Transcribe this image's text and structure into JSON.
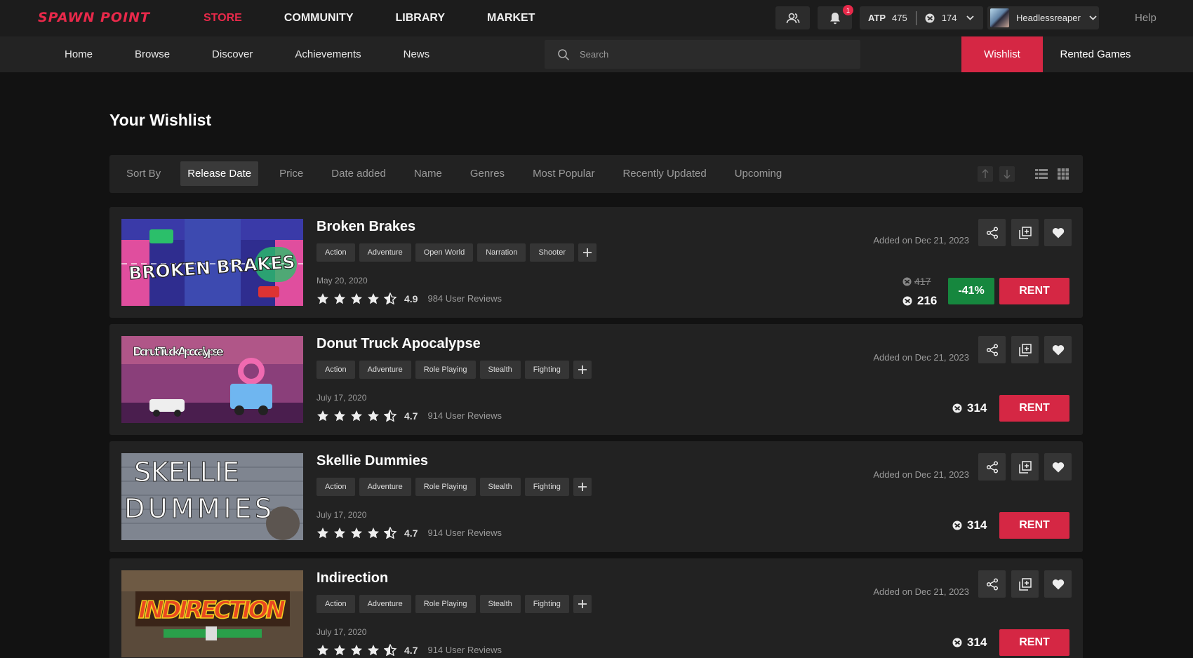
{
  "topbar": {
    "logo": "SPAWN POINT",
    "nav": [
      "STORE",
      "COMMUNITY",
      "LIBRARY",
      "MARKET"
    ],
    "active_nav": "STORE",
    "notifications": "1",
    "atp_label": "ATP",
    "atp_value": "475",
    "coins": "174",
    "username": "Headlessreaper",
    "help": "Help"
  },
  "subbar": {
    "nav": [
      "Home",
      "Browse",
      "Discover",
      "Achievements",
      "News"
    ],
    "search_placeholder": "Search",
    "wishlist_tab": "Wishlist",
    "rented_tab": "Rented Games"
  },
  "page": {
    "title": "Your Wishlist"
  },
  "sort": {
    "label": "Sort By",
    "options": [
      "Release Date",
      "Price",
      "Date added",
      "Name",
      "Genres",
      "Most Popular",
      "Recently Updated",
      "Upcoming"
    ],
    "active": "Release Date"
  },
  "colors": {
    "accent": "#d52744",
    "discount": "#16873e",
    "background": "#121212",
    "card": "#222222"
  },
  "games": [
    {
      "title": "Broken Brakes",
      "thumb_text": "BROKEN BRAKES",
      "tags": [
        "Action",
        "Adventure",
        "Open World",
        "Narration",
        "Shooter"
      ],
      "release": "May 20, 2020",
      "rating": "4.9",
      "stars": 4.5,
      "reviews": "984 User Reviews",
      "added": "Added on Dec 21, 2023",
      "old_price": "417",
      "price": "216",
      "discount": "-41%",
      "rent": "RENT"
    },
    {
      "title": "Donut Truck Apocalypse",
      "thumb_text": "Donut Truck Apocalypse",
      "tags": [
        "Action",
        "Adventure",
        "Role Playing",
        "Stealth",
        "Fighting"
      ],
      "release": "July 17, 2020",
      "rating": "4.7",
      "stars": 4.5,
      "reviews": "914 User Reviews",
      "added": "Added on Dec 21, 2023",
      "price": "314",
      "rent": "RENT"
    },
    {
      "title": "Skellie Dummies",
      "thumb_text": "SKELLIE DUMMIES",
      "tags": [
        "Action",
        "Adventure",
        "Role Playing",
        "Stealth",
        "Fighting"
      ],
      "release": "July 17, 2020",
      "rating": "4.7",
      "stars": 4.5,
      "reviews": "914 User Reviews",
      "added": "Added on Dec 21, 2023",
      "price": "314",
      "rent": "RENT"
    },
    {
      "title": "Indirection",
      "thumb_text": "INDIRECTION",
      "tags": [
        "Action",
        "Adventure",
        "Role Playing",
        "Stealth",
        "Fighting"
      ],
      "release": "July 17, 2020",
      "rating": "4.7",
      "stars": 4.5,
      "reviews": "914 User Reviews",
      "added": "Added on Dec 21, 2023",
      "price": "314",
      "rent": "RENT"
    }
  ]
}
